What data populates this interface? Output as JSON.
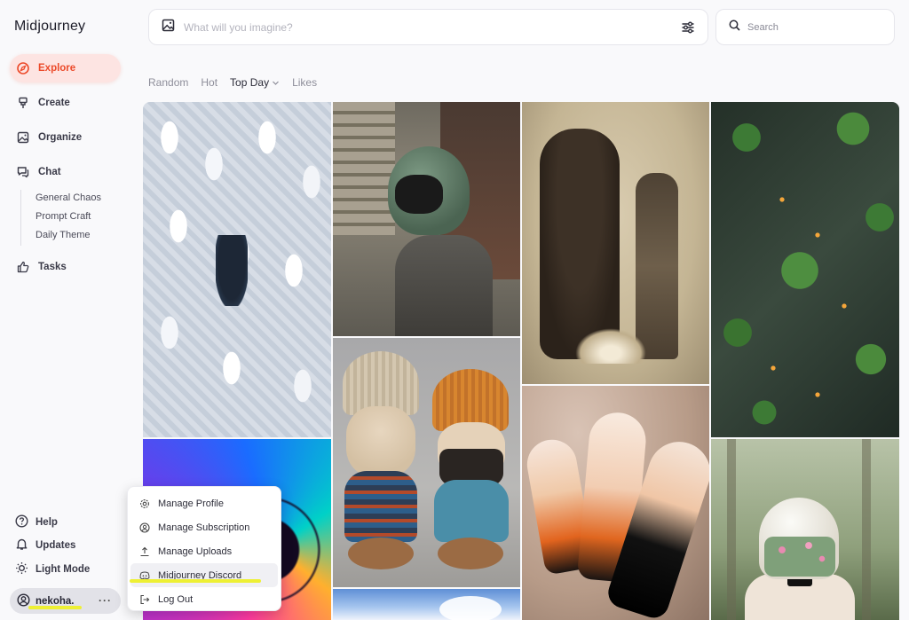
{
  "app": {
    "title": "Midjourney"
  },
  "sidebar": {
    "nav": [
      {
        "label": "Explore",
        "icon": "compass-icon",
        "active": true
      },
      {
        "label": "Create",
        "icon": "brush-icon"
      },
      {
        "label": "Organize",
        "icon": "image-icon"
      },
      {
        "label": "Chat",
        "icon": "chat-icon"
      },
      {
        "label": "Tasks",
        "icon": "thumbs-up-icon"
      }
    ],
    "chat_rooms": [
      "General Chaos",
      "Prompt Craft",
      "Daily Theme"
    ],
    "bottom": [
      {
        "label": "Help",
        "icon": "help-circle-icon"
      },
      {
        "label": "Updates",
        "icon": "bell-icon"
      },
      {
        "label": "Light Mode",
        "icon": "sun-icon"
      }
    ],
    "user": {
      "name": "nekoha.",
      "more": "···"
    }
  },
  "prompt": {
    "placeholder": "What will you imagine?"
  },
  "search": {
    "placeholder": "Search"
  },
  "feed_tabs": {
    "items": [
      "Random",
      "Hot",
      "Top Day",
      "Likes"
    ],
    "selected": "Top Day"
  },
  "user_menu": {
    "items": [
      {
        "label": "Manage Profile",
        "icon": "gear-icon"
      },
      {
        "label": "Manage Subscription",
        "icon": "user-circle-icon"
      },
      {
        "label": "Manage Uploads",
        "icon": "upload-icon"
      },
      {
        "label": "Midjourney Discord",
        "icon": "discord-icon"
      },
      {
        "label": "Log Out",
        "icon": "logout-icon"
      }
    ]
  },
  "colors": {
    "accent": "#ec4a2a",
    "active_bg": "#fde4e2",
    "highlight": "#eef034"
  }
}
